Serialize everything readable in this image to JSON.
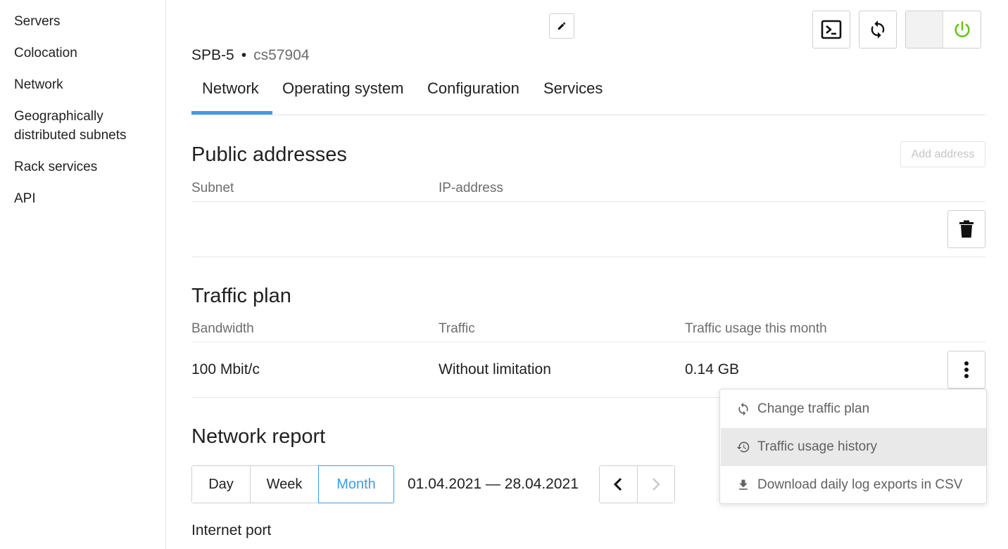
{
  "sidebar": {
    "items": [
      {
        "label": "Servers"
      },
      {
        "label": "Colocation"
      },
      {
        "label": "Network"
      },
      {
        "label": "Geographically distributed subnets"
      },
      {
        "label": "Rack services"
      },
      {
        "label": "API"
      }
    ]
  },
  "header": {
    "location": "SPB-5",
    "separator": "•",
    "server_id": "cs57904",
    "icons": {
      "edit": "pencil-icon",
      "console": "terminal-icon",
      "reboot": "refresh-icon",
      "power": "power-icon"
    },
    "power_color": "#6cc417"
  },
  "tabs": [
    {
      "label": "Network",
      "active": true
    },
    {
      "label": "Operating system",
      "active": false
    },
    {
      "label": "Configuration",
      "active": false
    },
    {
      "label": "Services",
      "active": false
    }
  ],
  "accent_color": "#3d9be9",
  "public_addresses": {
    "title": "Public addresses",
    "add_button": "Add address",
    "columns": [
      "Subnet",
      "IP-address"
    ],
    "delete_icon": "trash-icon"
  },
  "traffic_plan": {
    "title": "Traffic plan",
    "columns": [
      "Bandwidth",
      "Traffic",
      "Traffic usage this month"
    ],
    "row": {
      "bandwidth": "100 Mbit/c",
      "traffic": "Without limitation",
      "usage": "0.14 GB"
    },
    "menu_icon": "more-vertical-icon"
  },
  "menu": {
    "items": [
      {
        "label": "Change traffic plan",
        "icon": "refresh-icon",
        "highlighted": false
      },
      {
        "label": "Traffic usage history",
        "icon": "history-icon",
        "highlighted": true
      },
      {
        "label": "Download daily log exports in CSV",
        "icon": "download-icon",
        "highlighted": false
      }
    ]
  },
  "network_report": {
    "title": "Network report",
    "periods": [
      {
        "label": "Day",
        "active": false
      },
      {
        "label": "Week",
        "active": false
      },
      {
        "label": "Month",
        "active": true
      }
    ],
    "range": "01.04.2021 — 28.04.2021",
    "subsection": "Internet port"
  }
}
